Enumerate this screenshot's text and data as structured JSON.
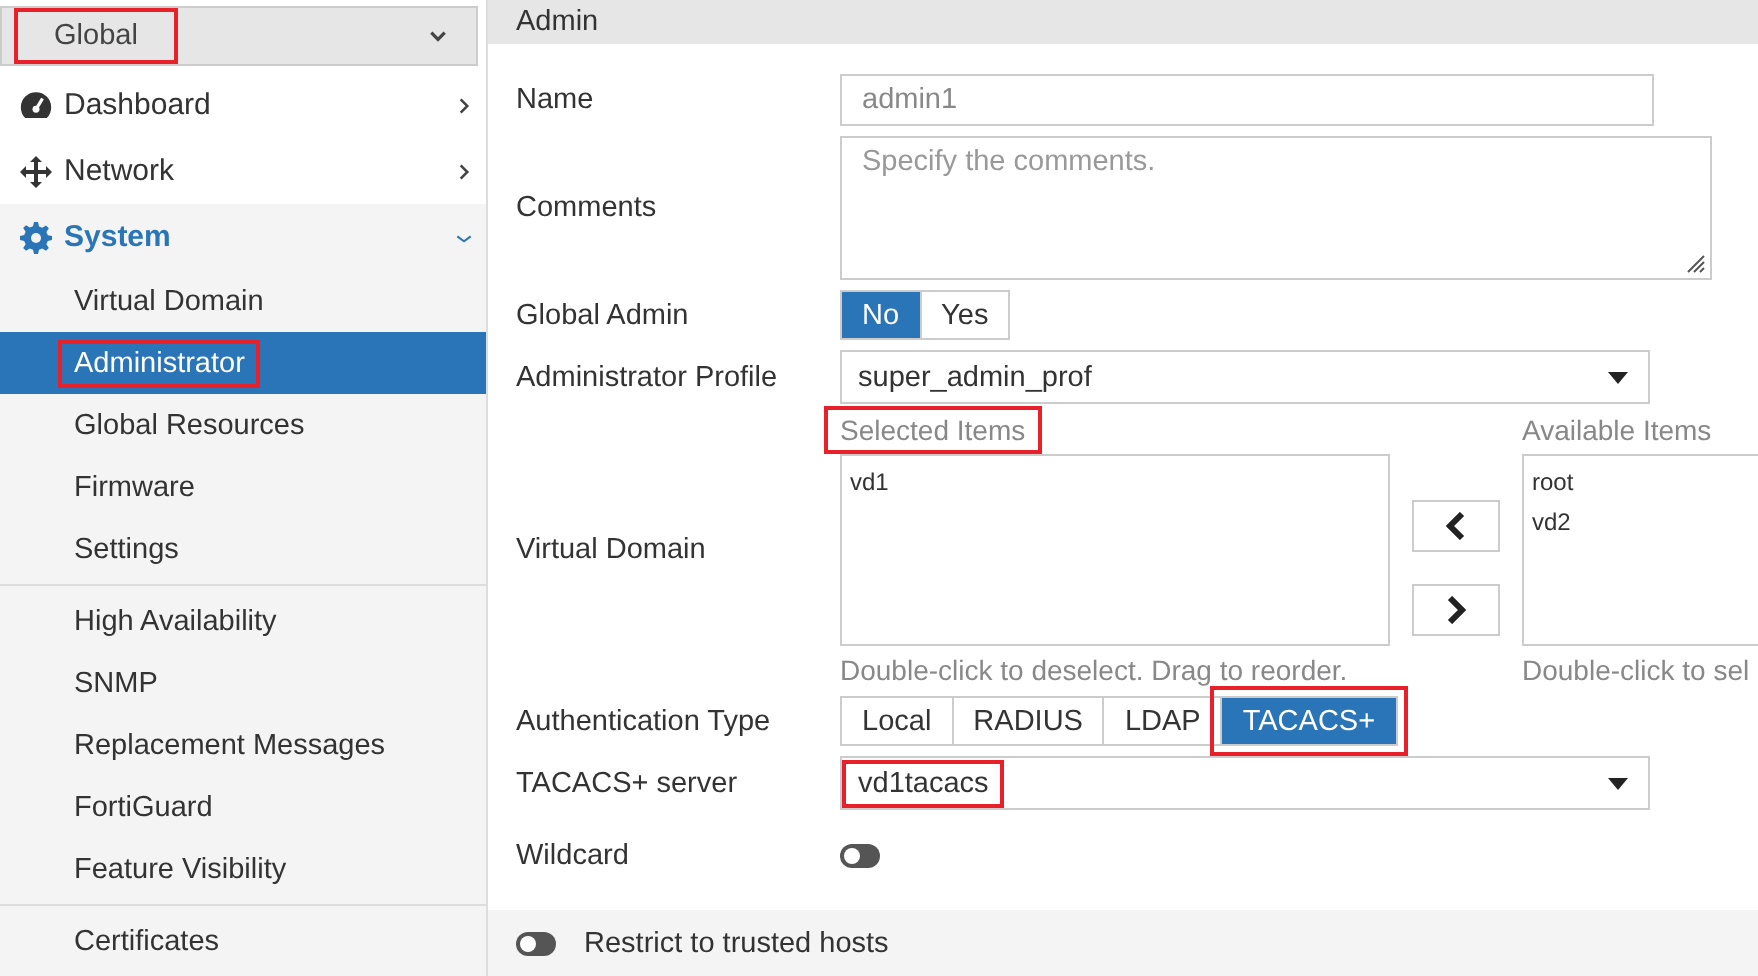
{
  "scope_select": {
    "value": "Global",
    "highlighted": true
  },
  "sidebar": {
    "items": [
      {
        "label": "Dashboard",
        "expanded": false
      },
      {
        "label": "Network",
        "expanded": false
      },
      {
        "label": "System",
        "expanded": true,
        "groups": [
          {
            "items": [
              {
                "label": "Virtual Domain",
                "selected": false,
                "highlighted": false
              },
              {
                "label": "Administrator",
                "selected": true,
                "highlighted": true
              },
              {
                "label": "Global Resources",
                "selected": false,
                "highlighted": false
              },
              {
                "label": "Firmware",
                "selected": false,
                "highlighted": false
              },
              {
                "label": "Settings",
                "selected": false,
                "highlighted": false
              }
            ]
          },
          {
            "items": [
              {
                "label": "High Availability",
                "selected": false,
                "highlighted": false
              },
              {
                "label": "SNMP",
                "selected": false,
                "highlighted": false
              },
              {
                "label": "Replacement Messages",
                "selected": false,
                "highlighted": false
              },
              {
                "label": "FortiGuard",
                "selected": false,
                "highlighted": false
              },
              {
                "label": "Feature Visibility",
                "selected": false,
                "highlighted": false
              }
            ]
          },
          {
            "items": [
              {
                "label": "Certificates",
                "selected": false,
                "highlighted": false
              }
            ]
          }
        ]
      }
    ]
  },
  "form": {
    "title": "Admin",
    "fields": [
      {
        "kind": "text",
        "label": "Name",
        "value": "admin1",
        "disabled": true
      },
      {
        "kind": "textarea",
        "label": "Comments",
        "placeholder": "Specify the comments."
      },
      {
        "kind": "segmented",
        "label": "Global Admin",
        "options": [
          {
            "label": "No",
            "selected": true,
            "highlighted": false
          },
          {
            "label": "Yes",
            "selected": false,
            "highlighted": false
          }
        ]
      },
      {
        "kind": "select",
        "label": "Administrator Profile",
        "value": "super_admin_prof",
        "highlighted": false
      },
      {
        "kind": "dual_list",
        "label": "Virtual Domain",
        "selected_title": "Selected Items",
        "selected_highlighted": true,
        "selected_items": [
          "vd1"
        ],
        "selected_hint": "Double-click to deselect. Drag to reorder.",
        "available_title": "Available Items",
        "available_items": [
          "root",
          "vd2"
        ],
        "available_hint": "Double-click to sel"
      },
      {
        "kind": "segmented",
        "label": "Authentication Type",
        "options": [
          {
            "label": "Local",
            "selected": false,
            "highlighted": false
          },
          {
            "label": "RADIUS",
            "selected": false,
            "highlighted": false
          },
          {
            "label": "LDAP",
            "selected": false,
            "highlighted": false
          },
          {
            "label": "TACACS+",
            "selected": true,
            "highlighted": true
          }
        ]
      },
      {
        "kind": "select",
        "label": "TACACS+ server",
        "value": "vd1tacacs",
        "highlighted": true
      },
      {
        "kind": "toggle",
        "label": "Wildcard",
        "on": false
      }
    ]
  },
  "footer_toggle": {
    "label": "Restrict to trusted hosts",
    "on": false
  }
}
